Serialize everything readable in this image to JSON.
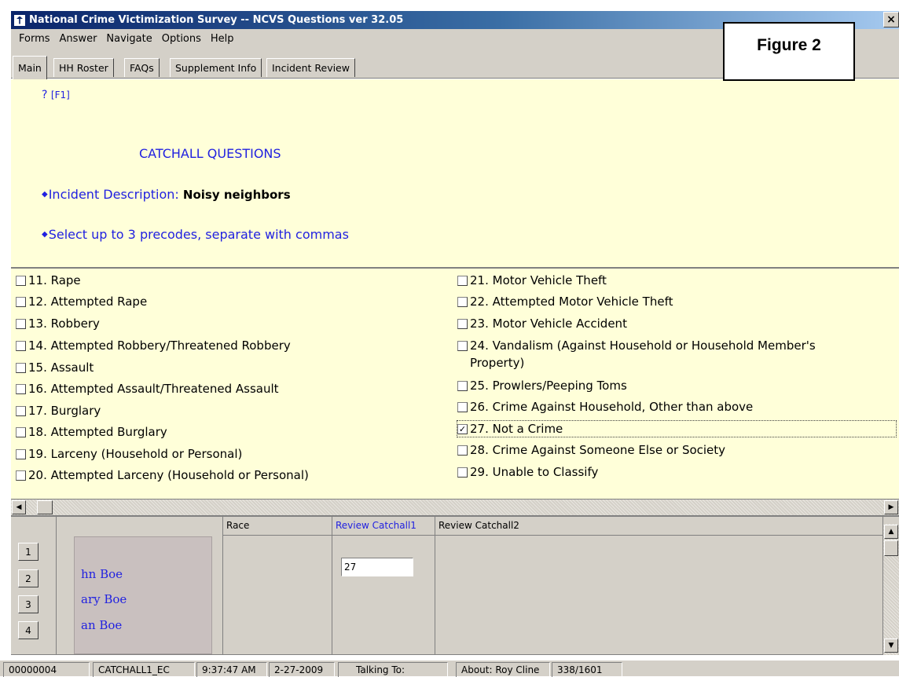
{
  "window": {
    "title": "National Crime Victimization Survey -- NCVS Questions ver 32.05",
    "close_glyph": "×"
  },
  "menu": [
    "Forms",
    "Answer",
    "Navigate",
    "Options",
    "Help"
  ],
  "figure_label": "Figure 2",
  "tabs": [
    "Main",
    "HH Roster",
    "FAQs",
    "Supplement Info",
    "Incident Review"
  ],
  "question": {
    "help_mark": "?",
    "help_key": "[F1]",
    "section_title": "CATCHALL QUESTIONS",
    "incident_label": "Incident Description:",
    "incident_value": "Noisy neighbors",
    "instruction": "Select up to 3 precodes, separate with commas"
  },
  "options": {
    "left": [
      {
        "label": "11. Rape",
        "checked": false
      },
      {
        "label": "12. Attempted Rape",
        "checked": false
      },
      {
        "label": "13. Robbery",
        "checked": false
      },
      {
        "label": "14. Attempted Robbery/Threatened Robbery",
        "checked": false
      },
      {
        "label": "15. Assault",
        "checked": false
      },
      {
        "label": "16. Attempted Assault/Threatened Assault",
        "checked": false
      },
      {
        "label": "17. Burglary",
        "checked": false
      },
      {
        "label": "18. Attempted Burglary",
        "checked": false
      },
      {
        "label": "19. Larceny (Household or Personal)",
        "checked": false
      },
      {
        "label": "20. Attempted Larceny (Household or Personal)",
        "checked": false
      }
    ],
    "right": [
      {
        "label": "21. Motor Vehicle Theft",
        "checked": false
      },
      {
        "label": "22. Attempted Motor Vehicle Theft",
        "checked": false
      },
      {
        "label": "23. Motor Vehicle Accident",
        "checked": false
      },
      {
        "label": "24. Vandalism (Against Household or Household Member's",
        "label_cont": "Property)",
        "checked": false
      },
      {
        "label": "25. Prowlers/Peeping Toms",
        "checked": false
      },
      {
        "label": "26. Crime Against Household, Other than above",
        "checked": false
      },
      {
        "label": "27. Not a Crime",
        "checked": true
      },
      {
        "label": "28. Crime Against Someone Else or Society",
        "checked": false
      },
      {
        "label": "29. Unable to Classify",
        "checked": false
      }
    ]
  },
  "grid": {
    "columns": [
      "Race",
      "Review Catchall1",
      "Review Catchall2"
    ],
    "rows": [
      "1",
      "2",
      "3",
      "4"
    ],
    "names": [
      "hn Boe",
      "ary Boe",
      "an Boe"
    ],
    "answer_value": "27"
  },
  "status": {
    "id": "00000004",
    "field": "CATCHALL1_EC",
    "time": "9:37:47 AM",
    "date": "2-27-2009",
    "talking_to": "Talking To:",
    "about": "About:  Roy Cline",
    "progress": "338/1601"
  },
  "colors": {
    "question_bg": "#ffffd9",
    "question_text": "#2121e0",
    "chrome": "#d4d0c8"
  }
}
